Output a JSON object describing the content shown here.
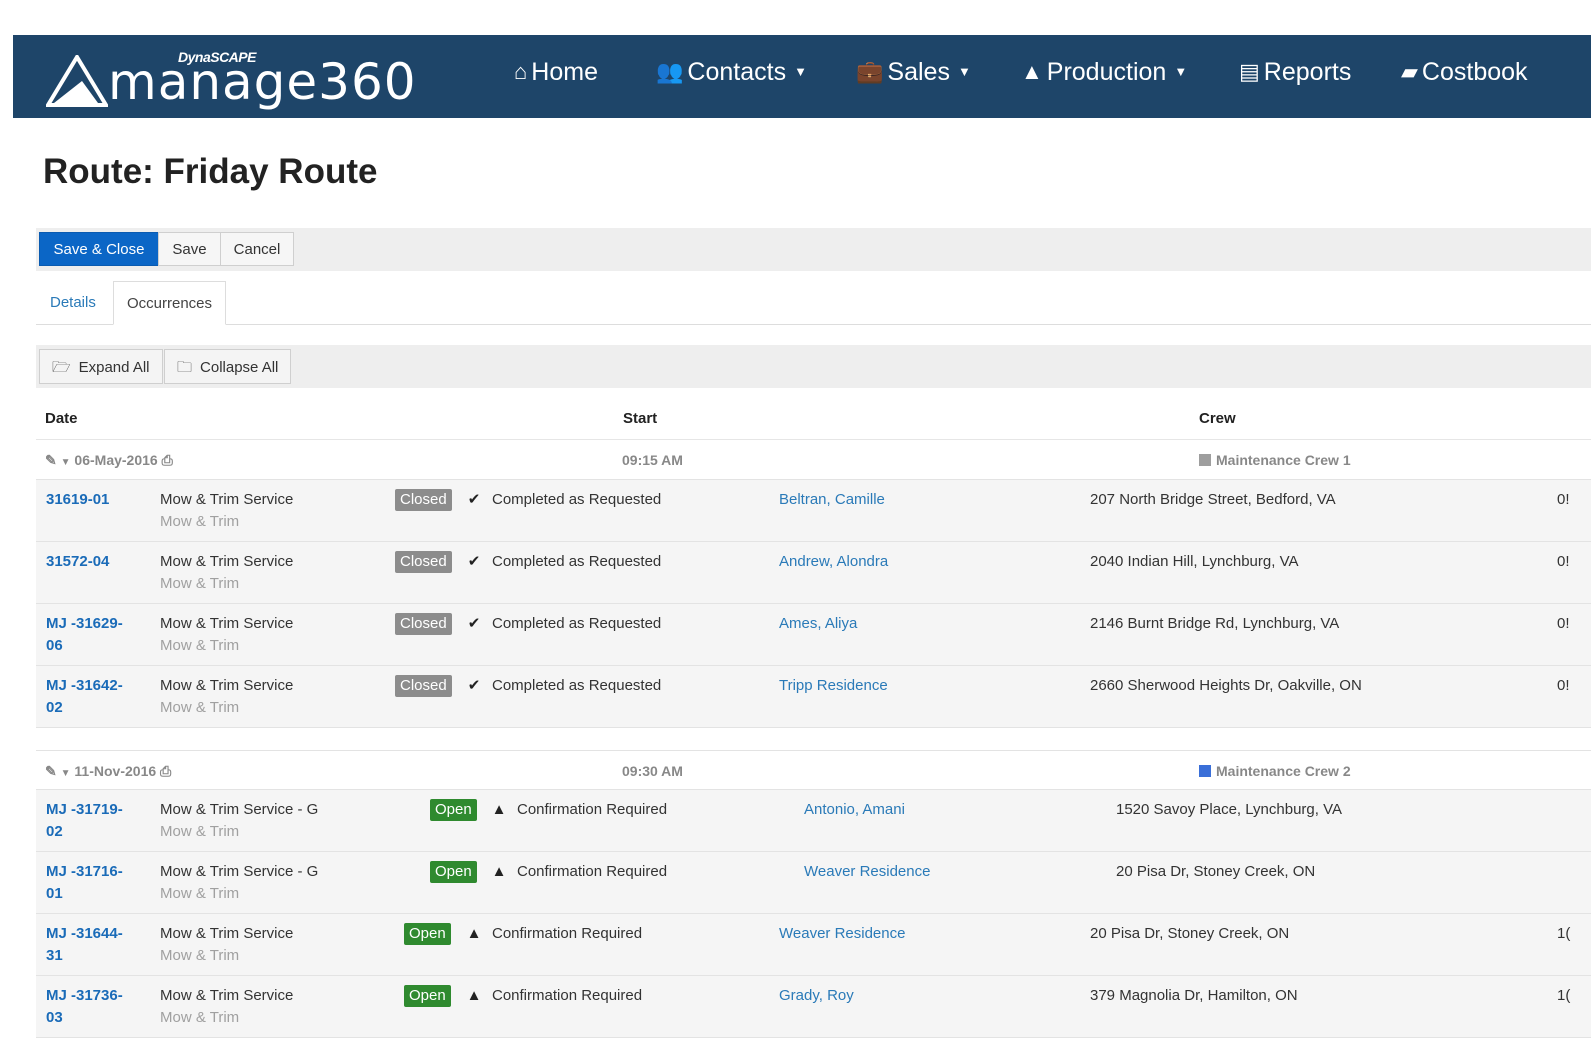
{
  "nav": {
    "brand": "DynaSCAPE",
    "logo_text": "manage360",
    "items": [
      {
        "label": "Home",
        "icon": "home-icon",
        "glyph": "⌂",
        "caret": false
      },
      {
        "label": "Contacts",
        "icon": "users-icon",
        "glyph": "👥",
        "caret": true
      },
      {
        "label": "Sales",
        "icon": "briefcase-icon",
        "glyph": "💼",
        "caret": true
      },
      {
        "label": "Production",
        "icon": "road-icon",
        "glyph": "▲",
        "caret": true
      },
      {
        "label": "Reports",
        "icon": "file-icon",
        "glyph": "▤",
        "caret": false
      },
      {
        "label": "Costbook",
        "icon": "book-icon",
        "glyph": "▰",
        "caret": false
      }
    ]
  },
  "page": {
    "title": "Route: Friday Route"
  },
  "toolbar": {
    "save_close": "Save & Close",
    "save": "Save",
    "cancel": "Cancel"
  },
  "tabs": [
    {
      "label": "Details"
    },
    {
      "label": "Occurrences"
    }
  ],
  "toolbar2": {
    "expand_all": "Expand All",
    "collapse_all": "Collapse All"
  },
  "columns": {
    "date": "Date",
    "start": "Start",
    "crew": "Crew"
  },
  "groups": [
    {
      "date": "06-May-2016",
      "start": "09:15 AM",
      "crew": "Maintenance Crew 1",
      "crew_color": "#9e9e9e",
      "rows": [
        {
          "id": "31619-01",
          "service": "Mow & Trim Service",
          "sub": "Mow & Trim",
          "badge": "Closed",
          "status": "Completed as Requested",
          "contact": "Beltran, Camille",
          "address": "207 North Bridge Street, Bedford, VA",
          "cut": "0!"
        },
        {
          "id": "31572-04",
          "service": "Mow & Trim Service",
          "sub": "Mow & Trim",
          "badge": "Closed",
          "status": "Completed as Requested",
          "contact": "Andrew, Alondra",
          "address": "2040 Indian Hill, Lynchburg, VA",
          "cut": "0!"
        },
        {
          "id": "MJ -31629-06",
          "service": "Mow & Trim Service",
          "sub": "Mow & Trim",
          "badge": "Closed",
          "status": "Completed as Requested",
          "contact": "Ames, Aliya",
          "address": "2146 Burnt Bridge Rd, Lynchburg, VA",
          "cut": "0!"
        },
        {
          "id": "MJ -31642-02",
          "service": "Mow & Trim Service",
          "sub": "Mow & Trim",
          "badge": "Closed",
          "status": "Completed as Requested",
          "contact": "Tripp Residence",
          "address": "2660 Sherwood Heights Dr, Oakville, ON",
          "cut": "0!"
        }
      ]
    },
    {
      "date": "11-Nov-2016",
      "start": "09:30 AM",
      "crew": "Maintenance Crew 2",
      "crew_color": "#3a6fd8",
      "rows": [
        {
          "id": "MJ -31719-02",
          "service": "Mow & Trim Service - G",
          "sub": "Mow & Trim",
          "badge": "Open",
          "status": "Confirmation Required",
          "contact": "Antonio, Amani",
          "address": "1520 Savoy Place, Lynchburg, VA",
          "cut": ""
        },
        {
          "id": "MJ -31716-01",
          "service": "Mow & Trim Service - G",
          "sub": "Mow & Trim",
          "badge": "Open",
          "status": "Confirmation Required",
          "contact": "Weaver Residence",
          "address": "20 Pisa Dr, Stoney Creek, ON",
          "cut": ""
        },
        {
          "id": "MJ -31644-31",
          "service": "Mow & Trim Service",
          "sub": "Mow & Trim",
          "badge": "Open",
          "status": "Confirmation Required",
          "contact": "Weaver Residence",
          "address": "20 Pisa Dr, Stoney Creek, ON",
          "cut": "1("
        },
        {
          "id": "MJ -31736-03",
          "service": "Mow & Trim Service",
          "sub": "Mow & Trim",
          "badge": "Open",
          "status": "Confirmation Required",
          "contact": "Grady, Roy",
          "address": "379 Magnolia Dr, Hamilton, ON",
          "cut": "1("
        }
      ]
    }
  ]
}
